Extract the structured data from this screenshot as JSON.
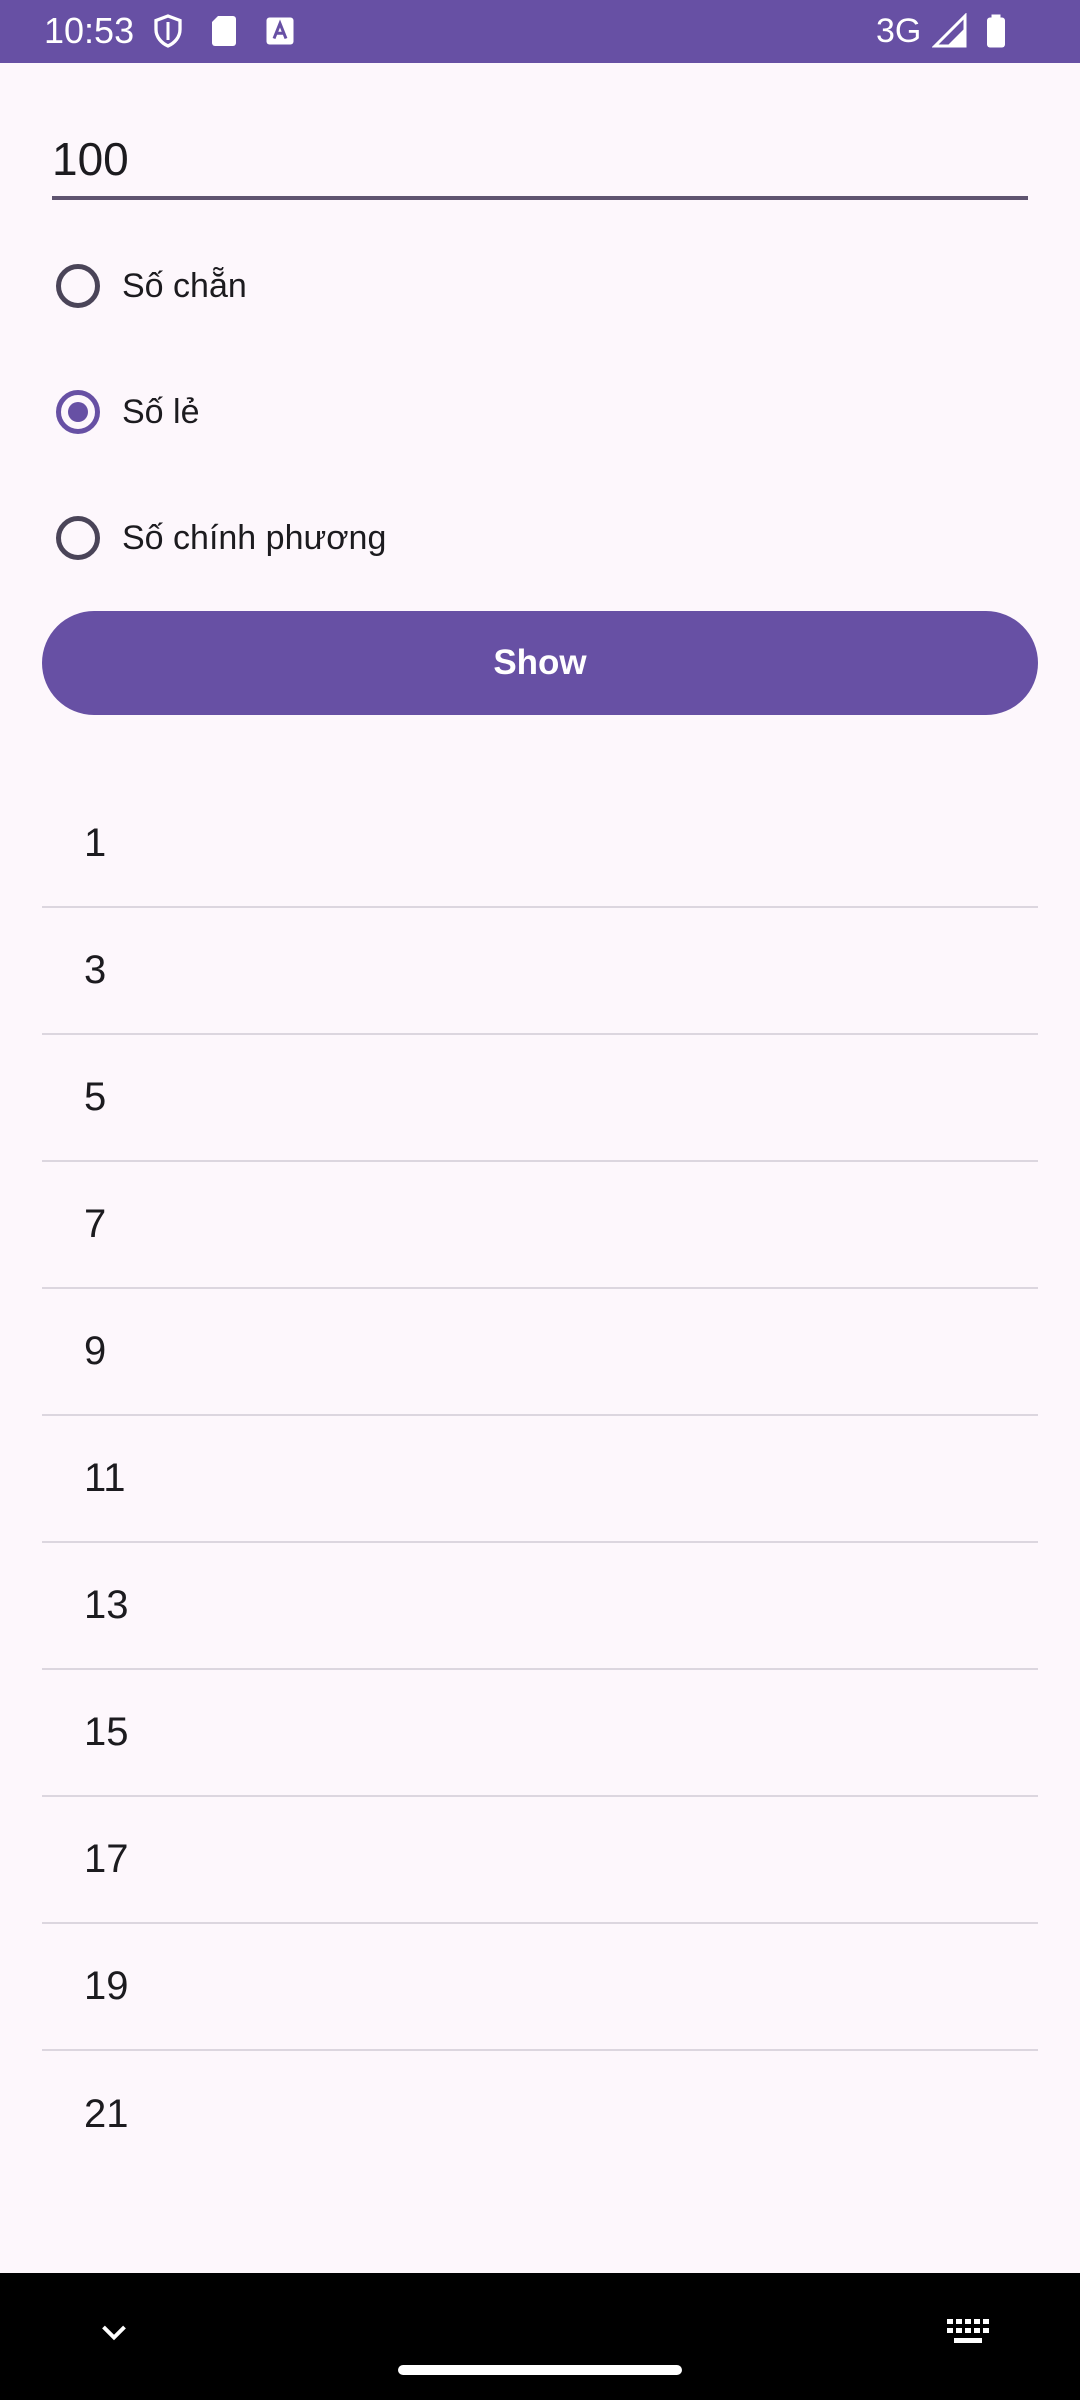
{
  "status_bar": {
    "time": "10:53",
    "network": "3G",
    "icons": [
      "shield-icon",
      "sd-card-icon",
      "text-a-icon",
      "signal-icon",
      "battery-icon"
    ],
    "background": "#6750a4"
  },
  "input": {
    "value": "100"
  },
  "radio_group": {
    "options": [
      {
        "label": "Số chẵn",
        "checked": false
      },
      {
        "label": "Số lẻ",
        "checked": true
      },
      {
        "label": "Số chính phương",
        "checked": false
      }
    ]
  },
  "show_button": {
    "label": "Show"
  },
  "results": [
    "1",
    "3",
    "5",
    "7",
    "9",
    "11",
    "13",
    "15",
    "17",
    "19",
    "21"
  ],
  "colors": {
    "accent": "#6750a4",
    "background": "#fdf7fc",
    "divider": "#dcd6df"
  }
}
